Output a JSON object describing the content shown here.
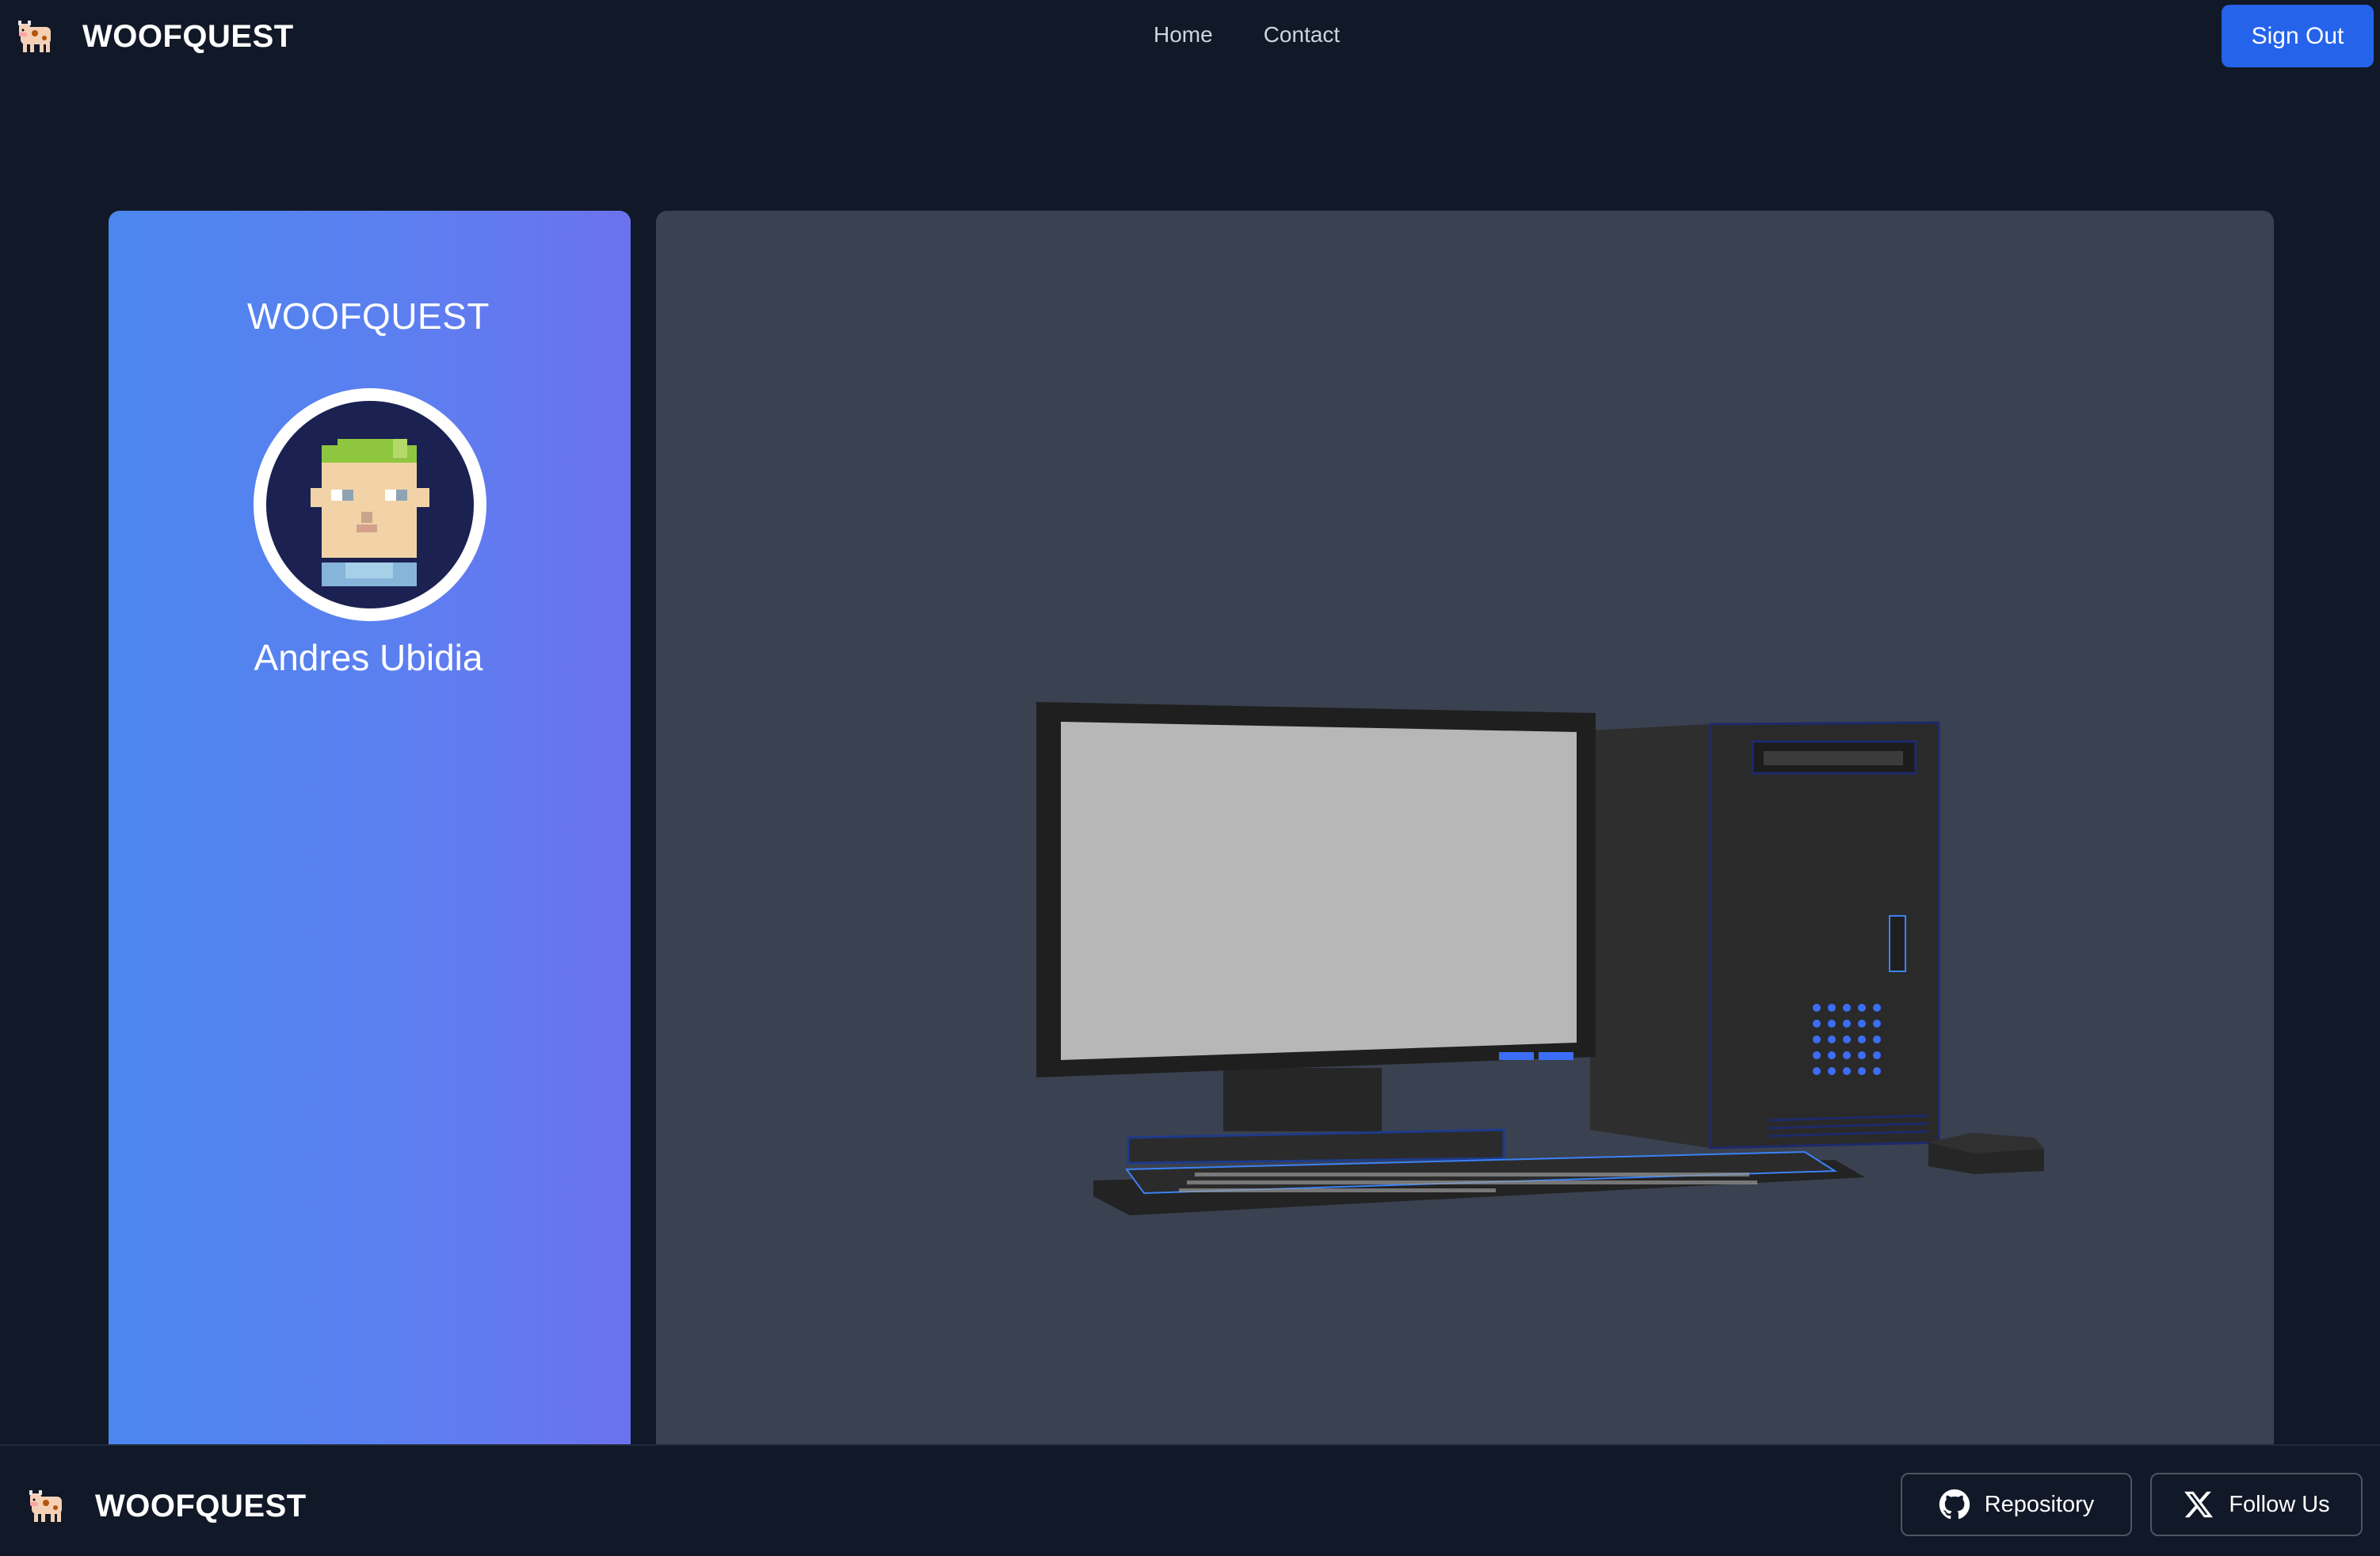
{
  "header": {
    "brand": "WOOFQUEST",
    "logo_icon": "cow-icon",
    "nav": [
      {
        "label": "Home"
      },
      {
        "label": "Contact"
      }
    ],
    "signout_label": "Sign Out"
  },
  "profile": {
    "title": "WOOFQUEST",
    "avatar_icon": "pixel-avatar",
    "name": "Andres Ubidia"
  },
  "scene": {
    "description_icon": "desktop-computer-3d-model"
  },
  "footer": {
    "brand": "WOOFQUEST",
    "logo_icon": "cow-icon",
    "repository_label": "Repository",
    "repository_icon": "github-icon",
    "follow_label": "Follow Us",
    "follow_icon": "x-icon"
  },
  "colors": {
    "background": "#111827",
    "accent": "#2563eb",
    "card_gradient_start": "#4b87ee",
    "card_gradient_end": "#6b72ee",
    "scene_background": "#3a4150"
  }
}
